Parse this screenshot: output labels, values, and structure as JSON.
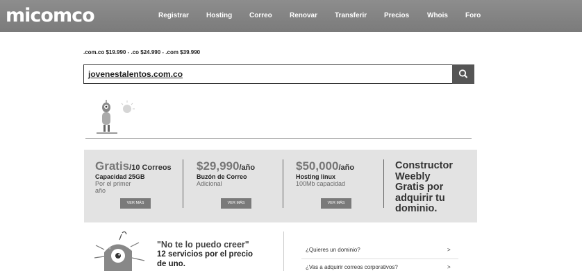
{
  "brand": {
    "logo": "micomco"
  },
  "nav": [
    "Registrar",
    "Hosting",
    "Correo",
    "Renovar",
    "Transferir",
    "Precios",
    "Whois",
    "Foro"
  ],
  "prices_line": ".com.co $19.990 - .co $24.990 - .com $39.990",
  "search": {
    "value": "jovenestalentos.com.co"
  },
  "features": [
    {
      "big": "Gratis",
      "suffix": "/10 Correos",
      "line1": "Capacidad 25GB",
      "line2": "Por el primer",
      "line3": "año",
      "button": "VER MÁS"
    },
    {
      "big": "$29,990",
      "suffix": "/año",
      "line1": "Buzón de Correo",
      "line2": "Adicional",
      "button": "VER MÁS"
    },
    {
      "big": "$50,000",
      "suffix": "/año",
      "line1": "Hosting linux",
      "line2": "100Mb capacidad",
      "button": "VER MÁS"
    }
  ],
  "constructor": [
    "Constructor",
    "Weebly",
    "Gratis por",
    "adquirir tu",
    "dominio."
  ],
  "quote": {
    "line1": "\"No te lo puedo creer\"",
    "line2": "12 servicios por el precio",
    "line3": "de uno."
  },
  "faq": [
    {
      "q": "¿Quieres un dominio?",
      "arrow": ">"
    },
    {
      "q": "¿Vas a adquirir correos corporativos?",
      "arrow": ">"
    }
  ]
}
